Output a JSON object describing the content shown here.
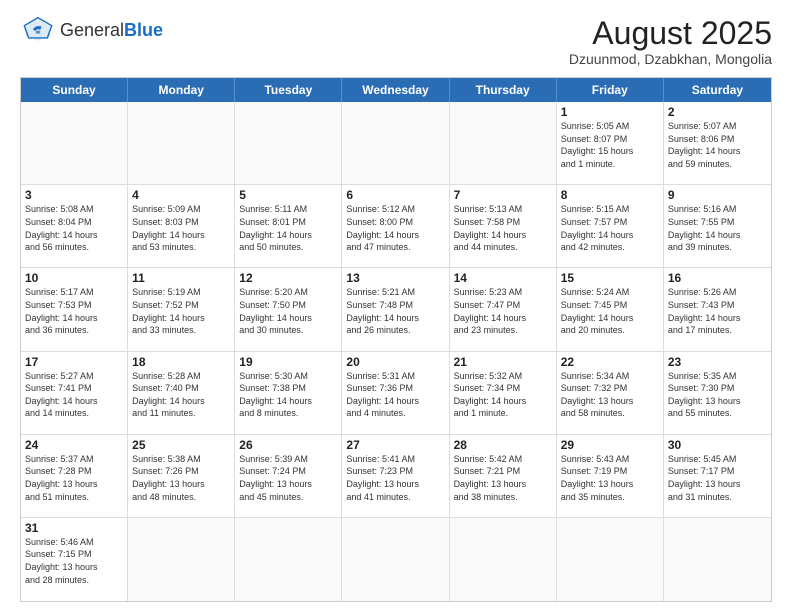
{
  "header": {
    "logo_general": "General",
    "logo_blue": "Blue",
    "month_title": "August 2025",
    "location": "Dzuunmod, Dzabkhan, Mongolia"
  },
  "weekdays": [
    "Sunday",
    "Monday",
    "Tuesday",
    "Wednesday",
    "Thursday",
    "Friday",
    "Saturday"
  ],
  "cells": [
    {
      "day": "",
      "empty": true,
      "info": ""
    },
    {
      "day": "",
      "empty": true,
      "info": ""
    },
    {
      "day": "",
      "empty": true,
      "info": ""
    },
    {
      "day": "",
      "empty": true,
      "info": ""
    },
    {
      "day": "",
      "empty": true,
      "info": ""
    },
    {
      "day": "1",
      "empty": false,
      "info": "Sunrise: 5:05 AM\nSunset: 8:07 PM\nDaylight: 15 hours\nand 1 minute."
    },
    {
      "day": "2",
      "empty": false,
      "info": "Sunrise: 5:07 AM\nSunset: 8:06 PM\nDaylight: 14 hours\nand 59 minutes."
    },
    {
      "day": "3",
      "empty": false,
      "info": "Sunrise: 5:08 AM\nSunset: 8:04 PM\nDaylight: 14 hours\nand 56 minutes."
    },
    {
      "day": "4",
      "empty": false,
      "info": "Sunrise: 5:09 AM\nSunset: 8:03 PM\nDaylight: 14 hours\nand 53 minutes."
    },
    {
      "day": "5",
      "empty": false,
      "info": "Sunrise: 5:11 AM\nSunset: 8:01 PM\nDaylight: 14 hours\nand 50 minutes."
    },
    {
      "day": "6",
      "empty": false,
      "info": "Sunrise: 5:12 AM\nSunset: 8:00 PM\nDaylight: 14 hours\nand 47 minutes."
    },
    {
      "day": "7",
      "empty": false,
      "info": "Sunrise: 5:13 AM\nSunset: 7:58 PM\nDaylight: 14 hours\nand 44 minutes."
    },
    {
      "day": "8",
      "empty": false,
      "info": "Sunrise: 5:15 AM\nSunset: 7:57 PM\nDaylight: 14 hours\nand 42 minutes."
    },
    {
      "day": "9",
      "empty": false,
      "info": "Sunrise: 5:16 AM\nSunset: 7:55 PM\nDaylight: 14 hours\nand 39 minutes."
    },
    {
      "day": "10",
      "empty": false,
      "info": "Sunrise: 5:17 AM\nSunset: 7:53 PM\nDaylight: 14 hours\nand 36 minutes."
    },
    {
      "day": "11",
      "empty": false,
      "info": "Sunrise: 5:19 AM\nSunset: 7:52 PM\nDaylight: 14 hours\nand 33 minutes."
    },
    {
      "day": "12",
      "empty": false,
      "info": "Sunrise: 5:20 AM\nSunset: 7:50 PM\nDaylight: 14 hours\nand 30 minutes."
    },
    {
      "day": "13",
      "empty": false,
      "info": "Sunrise: 5:21 AM\nSunset: 7:48 PM\nDaylight: 14 hours\nand 26 minutes."
    },
    {
      "day": "14",
      "empty": false,
      "info": "Sunrise: 5:23 AM\nSunset: 7:47 PM\nDaylight: 14 hours\nand 23 minutes."
    },
    {
      "day": "15",
      "empty": false,
      "info": "Sunrise: 5:24 AM\nSunset: 7:45 PM\nDaylight: 14 hours\nand 20 minutes."
    },
    {
      "day": "16",
      "empty": false,
      "info": "Sunrise: 5:26 AM\nSunset: 7:43 PM\nDaylight: 14 hours\nand 17 minutes."
    },
    {
      "day": "17",
      "empty": false,
      "info": "Sunrise: 5:27 AM\nSunset: 7:41 PM\nDaylight: 14 hours\nand 14 minutes."
    },
    {
      "day": "18",
      "empty": false,
      "info": "Sunrise: 5:28 AM\nSunset: 7:40 PM\nDaylight: 14 hours\nand 11 minutes."
    },
    {
      "day": "19",
      "empty": false,
      "info": "Sunrise: 5:30 AM\nSunset: 7:38 PM\nDaylight: 14 hours\nand 8 minutes."
    },
    {
      "day": "20",
      "empty": false,
      "info": "Sunrise: 5:31 AM\nSunset: 7:36 PM\nDaylight: 14 hours\nand 4 minutes."
    },
    {
      "day": "21",
      "empty": false,
      "info": "Sunrise: 5:32 AM\nSunset: 7:34 PM\nDaylight: 14 hours\nand 1 minute."
    },
    {
      "day": "22",
      "empty": false,
      "info": "Sunrise: 5:34 AM\nSunset: 7:32 PM\nDaylight: 13 hours\nand 58 minutes."
    },
    {
      "day": "23",
      "empty": false,
      "info": "Sunrise: 5:35 AM\nSunset: 7:30 PM\nDaylight: 13 hours\nand 55 minutes."
    },
    {
      "day": "24",
      "empty": false,
      "info": "Sunrise: 5:37 AM\nSunset: 7:28 PM\nDaylight: 13 hours\nand 51 minutes."
    },
    {
      "day": "25",
      "empty": false,
      "info": "Sunrise: 5:38 AM\nSunset: 7:26 PM\nDaylight: 13 hours\nand 48 minutes."
    },
    {
      "day": "26",
      "empty": false,
      "info": "Sunrise: 5:39 AM\nSunset: 7:24 PM\nDaylight: 13 hours\nand 45 minutes."
    },
    {
      "day": "27",
      "empty": false,
      "info": "Sunrise: 5:41 AM\nSunset: 7:23 PM\nDaylight: 13 hours\nand 41 minutes."
    },
    {
      "day": "28",
      "empty": false,
      "info": "Sunrise: 5:42 AM\nSunset: 7:21 PM\nDaylight: 13 hours\nand 38 minutes."
    },
    {
      "day": "29",
      "empty": false,
      "info": "Sunrise: 5:43 AM\nSunset: 7:19 PM\nDaylight: 13 hours\nand 35 minutes."
    },
    {
      "day": "30",
      "empty": false,
      "info": "Sunrise: 5:45 AM\nSunset: 7:17 PM\nDaylight: 13 hours\nand 31 minutes."
    },
    {
      "day": "31",
      "empty": false,
      "info": "Sunrise: 5:46 AM\nSunset: 7:15 PM\nDaylight: 13 hours\nand 28 minutes."
    },
    {
      "day": "",
      "empty": true,
      "info": ""
    },
    {
      "day": "",
      "empty": true,
      "info": ""
    },
    {
      "day": "",
      "empty": true,
      "info": ""
    },
    {
      "day": "",
      "empty": true,
      "info": ""
    },
    {
      "day": "",
      "empty": true,
      "info": ""
    },
    {
      "day": "",
      "empty": true,
      "info": ""
    }
  ]
}
